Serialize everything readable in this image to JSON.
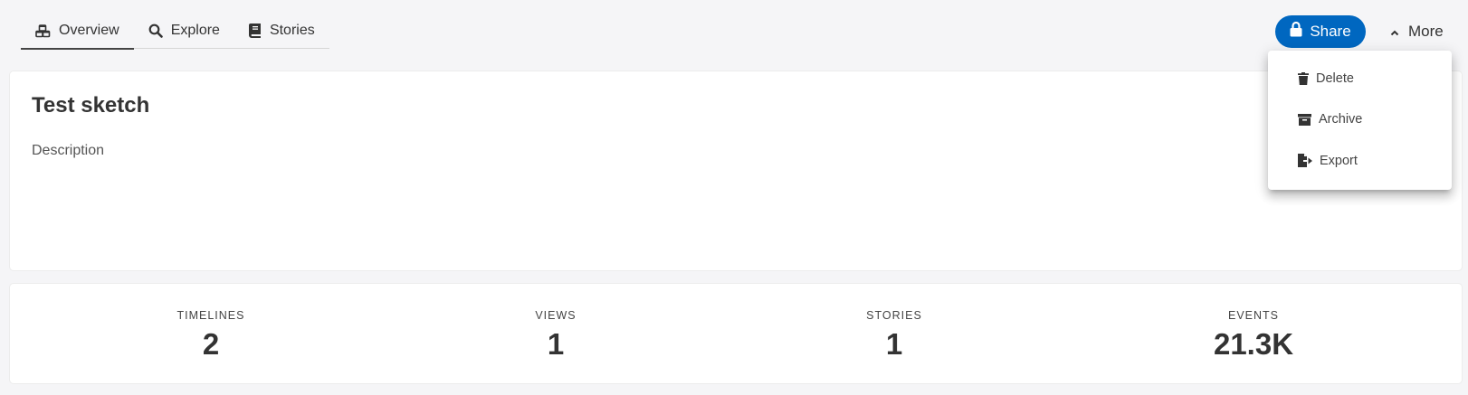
{
  "tabs": [
    {
      "label": "Overview",
      "icon": "cubes-icon",
      "active": true
    },
    {
      "label": "Explore",
      "icon": "search-icon",
      "active": false
    },
    {
      "label": "Stories",
      "icon": "book-icon",
      "active": false
    }
  ],
  "header": {
    "share_label": "Share",
    "share_icon": "lock-icon",
    "more_label": "More",
    "more_icon": "chevron-up-icon"
  },
  "colors": {
    "accent": "#0067c0",
    "background": "#f5f5f7"
  },
  "more_menu": {
    "items": [
      {
        "label": "Delete",
        "icon": "trash-icon"
      },
      {
        "label": "Archive",
        "icon": "archive-icon"
      },
      {
        "label": "Export",
        "icon": "file-export-icon"
      }
    ]
  },
  "sketch": {
    "title": "Test sketch",
    "description": "Description"
  },
  "stats": [
    {
      "label": "TIMELINES",
      "value": "2"
    },
    {
      "label": "VIEWS",
      "value": "1"
    },
    {
      "label": "STORIES",
      "value": "1"
    },
    {
      "label": "EVENTS",
      "value": "21.3K"
    }
  ]
}
